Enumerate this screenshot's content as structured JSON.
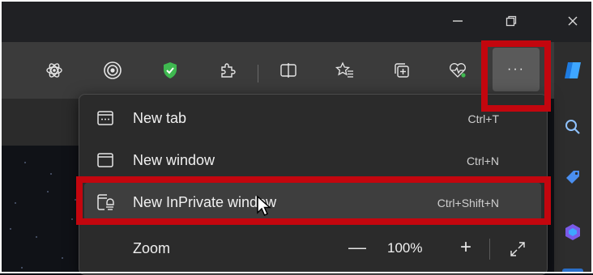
{
  "window_controls": {
    "minimize": "—",
    "restore": "⧉",
    "close": "✕"
  },
  "toolbar": {
    "icons": [
      "tab-edge-icon",
      "atom-extension-icon",
      "target-extension-icon",
      "shield-check-extension-icon",
      "puzzle-extensions-icon",
      "split-screen-icon",
      "favorites-icon",
      "collections-icon",
      "performance-icon"
    ],
    "more_label": "···"
  },
  "sidebar": {
    "icons": [
      "copilot-icon",
      "search-icon",
      "tag-icon",
      "office-icon"
    ]
  },
  "menu": {
    "items": [
      {
        "label": "New tab",
        "shortcut": "Ctrl+T",
        "icon": "new-tab-icon"
      },
      {
        "label": "New window",
        "shortcut": "Ctrl+N",
        "icon": "new-window-icon"
      },
      {
        "label": "New InPrivate window",
        "shortcut": "Ctrl+Shift+N",
        "icon": "inprivate-window-icon"
      }
    ],
    "zoom": {
      "label": "Zoom",
      "minus": "—",
      "value": "100%",
      "plus": "+",
      "fullscreen_icon": "fullscreen-icon"
    }
  },
  "colors": {
    "highlight": "#c3060e",
    "menu_bg": "#2b2b2b",
    "toolbar_bg": "#3b3b3b"
  }
}
